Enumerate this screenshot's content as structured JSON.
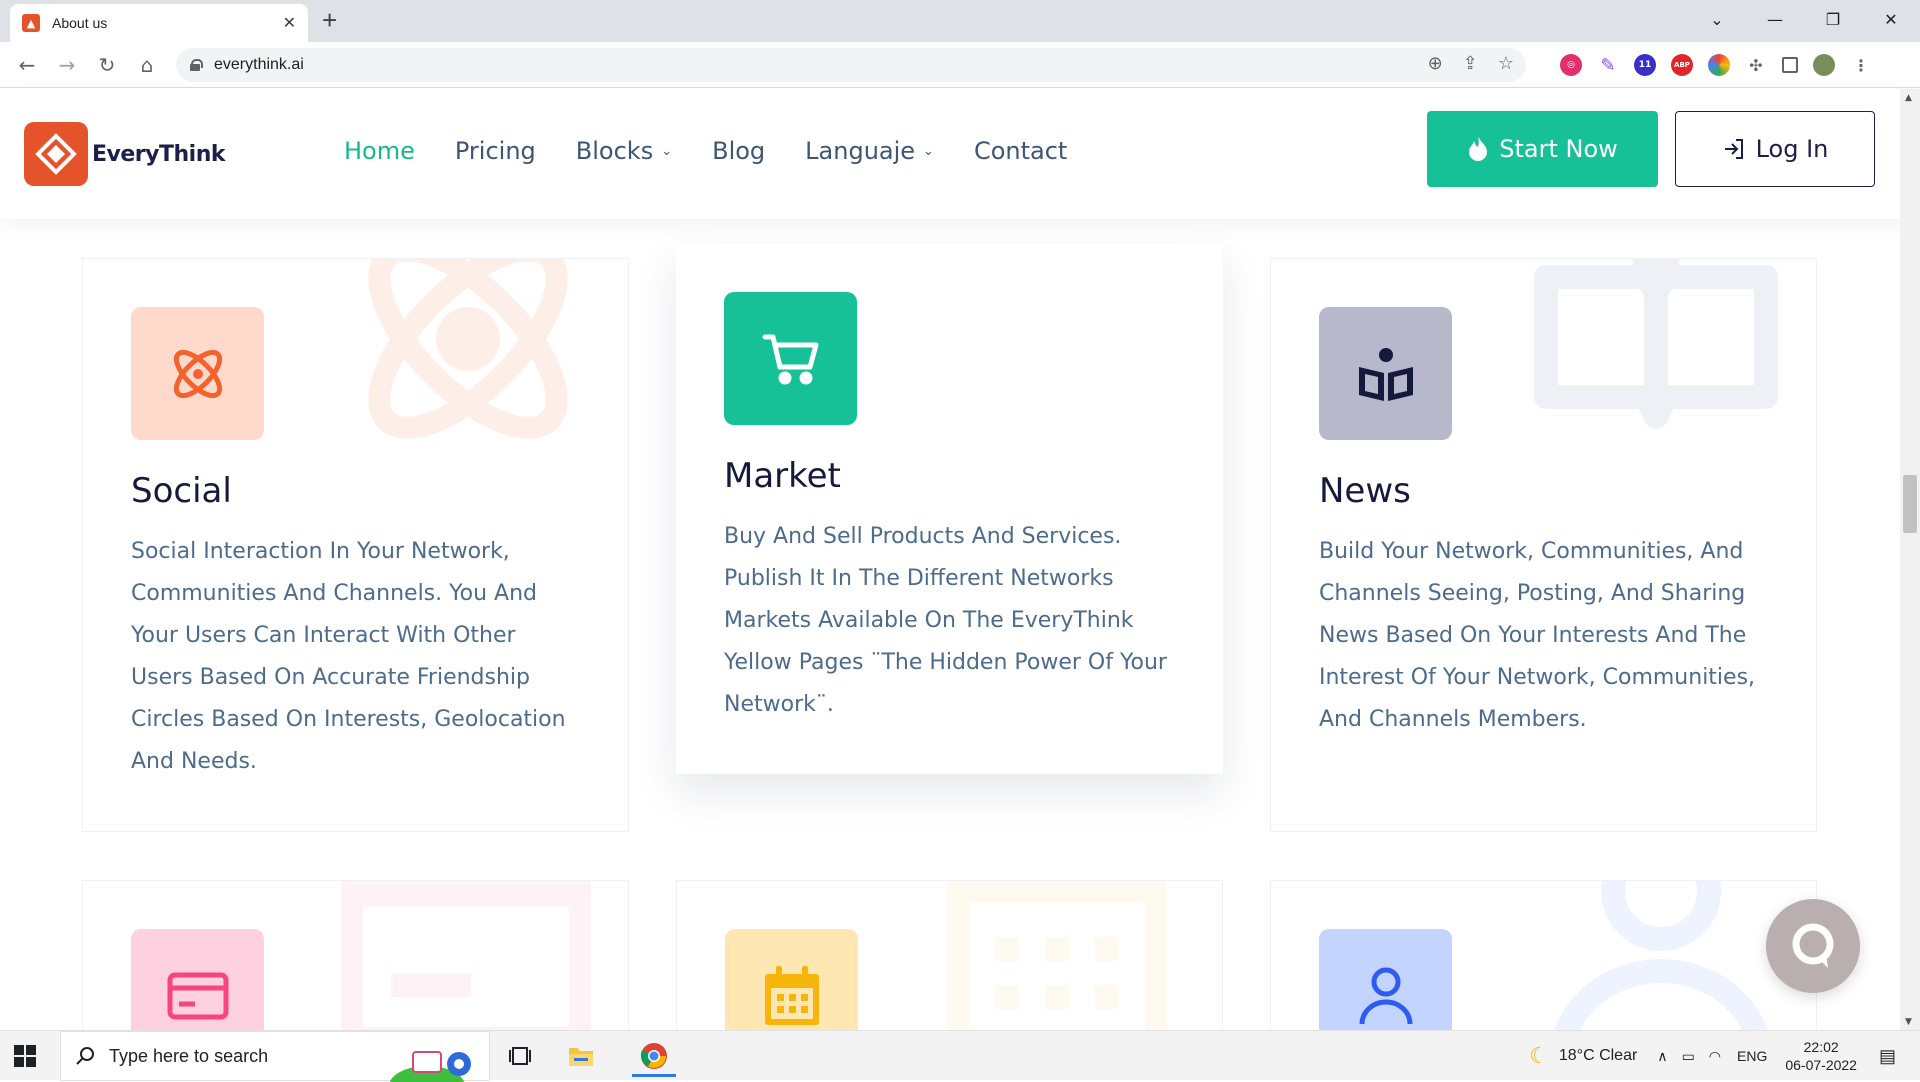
{
  "browser": {
    "tab_title": "About us",
    "tab_close": "✕",
    "new_tab": "+",
    "url": "everythink.ai",
    "ext_badge": "11",
    "ext_abp": "ABP"
  },
  "site": {
    "brand": "EveryThink",
    "nav": [
      {
        "label": "Home",
        "active": true
      },
      {
        "label": "Pricing"
      },
      {
        "label": "Blocks",
        "dropdown": true
      },
      {
        "label": "Blog"
      },
      {
        "label": "Languaje",
        "dropdown": true
      },
      {
        "label": "Contact"
      }
    ],
    "start_label": "Start Now",
    "login_label": "Log In",
    "accent": "#17C197"
  },
  "cards": [
    {
      "title": "Social",
      "desc": "Social Interaction In Your Network, Communities And Channels. You And Your Users Can Interact With Other Users Based On Accurate Friendship Circles Based On Interests, Geolocation And Needs.",
      "icon": "atom-icon",
      "icon_bg": "#FFD9CC",
      "icon_color": "#F4622E"
    },
    {
      "title": "Market",
      "desc": "Buy And Sell Products And Services. Publish It In The Different Networks Markets Available On The EveryThink Yellow Pages ¨The Hidden Power Of Your Network¨.",
      "icon": "cart-icon",
      "icon_bg": "#17C197",
      "icon_color": "#FFFFFF"
    },
    {
      "title": "News",
      "desc": "Build Your Network, Communities, And Channels Seeing, Posting, And Sharing News Based On Your Interests And The Interest Of Your Network, Communities, And Channels Members.",
      "icon": "book-reader-icon",
      "icon_bg": "#B8B8CC",
      "icon_color": "#151A3D"
    },
    {
      "icon": "credit-card-icon",
      "icon_bg": "#FFD0E0",
      "icon_color": "#F7457E"
    },
    {
      "icon": "calendar-icon",
      "icon_bg": "#FFE7B3",
      "icon_color": "#F5B50A"
    },
    {
      "icon": "user-icon",
      "icon_bg": "#C2D4FF",
      "icon_color": "#2E5BF0"
    }
  ],
  "taskbar": {
    "search_placeholder": "Type here to search",
    "weather": "18°C  Clear",
    "lang": "ENG",
    "time": "22:02",
    "date": "06-07-2022"
  }
}
